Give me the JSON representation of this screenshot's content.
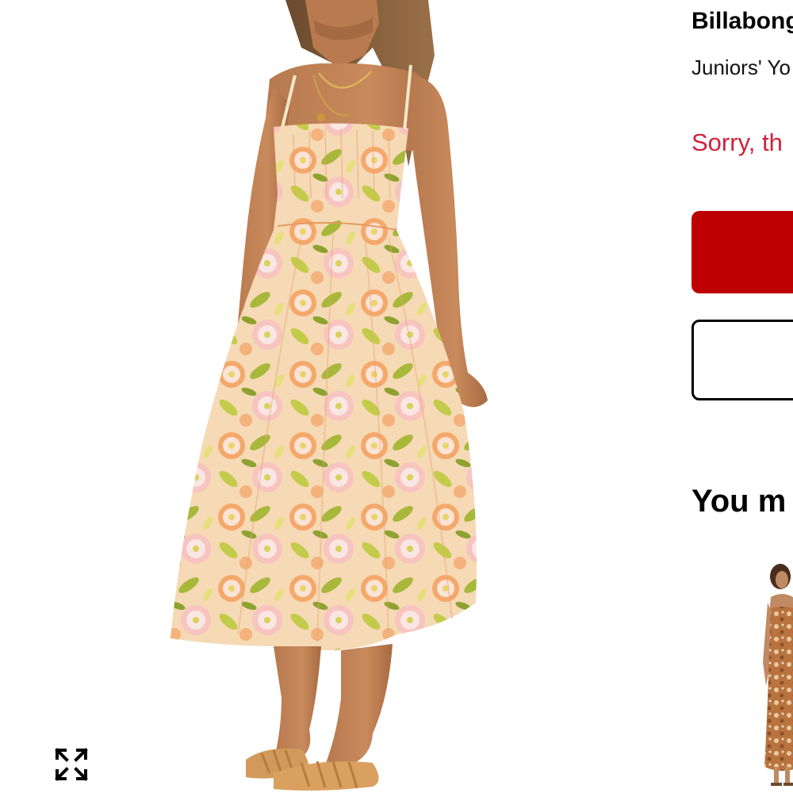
{
  "product": {
    "brand": "Billabong",
    "name": "Juniors' Yo",
    "availability_message": "Sorry, th",
    "primary_button_label": "",
    "secondary_button_label": "",
    "image_alt": "Woman wearing a floral print midi dress with spaghetti straps"
  },
  "recommendations": {
    "heading": "You m",
    "items": [
      {
        "image_alt": "Woman wearing a brown patterned maxi dress"
      }
    ]
  },
  "icons": {
    "expand": "expand-icon"
  },
  "colors": {
    "sold_out_text": "#d0223b",
    "primary_button": "#bd0000",
    "secondary_button_border": "#000000"
  }
}
